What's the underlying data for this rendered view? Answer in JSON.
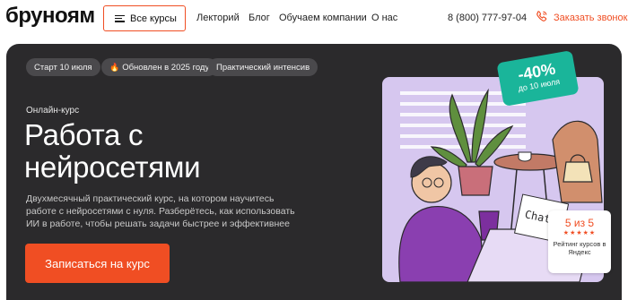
{
  "header": {
    "logo": "бруноям",
    "all_courses_label": "Все курсы",
    "nav": [
      "Лекторий",
      "Блог",
      "Обучаем компании",
      "О нас"
    ],
    "phone": "8 (800) 777-97-04",
    "call_label": "Заказать звонок"
  },
  "hero": {
    "chips": [
      "Старт 10 июля",
      "Обновлен в 2025 году",
      "Практический интенсив"
    ],
    "eyebrow": "Онлайн-курс",
    "title_line1": "Работа с",
    "title_line2": "нейросетями",
    "description": "Двухмесячный практический курс, на котором научитесь работе с нейросетями с нуля. Разберётесь, как использовать ИИ в работе, чтобы решать задачи быстрее и эффективнее",
    "cta_label": "Записаться на курс",
    "badge": {
      "discount": "-40%",
      "until": "до 10 июля"
    },
    "illustration_note": "Chat GPT",
    "rating": {
      "score": "5 из 5",
      "stars": "★★★★★",
      "label": "Рейтинг курсов в Яндекс"
    }
  },
  "colors": {
    "accent": "#f04e23",
    "hero_bg": "#2b2a2c",
    "chip_bg": "#4a494c",
    "badge_bg": "#1ab59a",
    "illustration_bg": "#d6c7ef"
  },
  "icons": [
    "menu-icon",
    "phone-call-icon",
    "fire-icon",
    "star-icon"
  ]
}
